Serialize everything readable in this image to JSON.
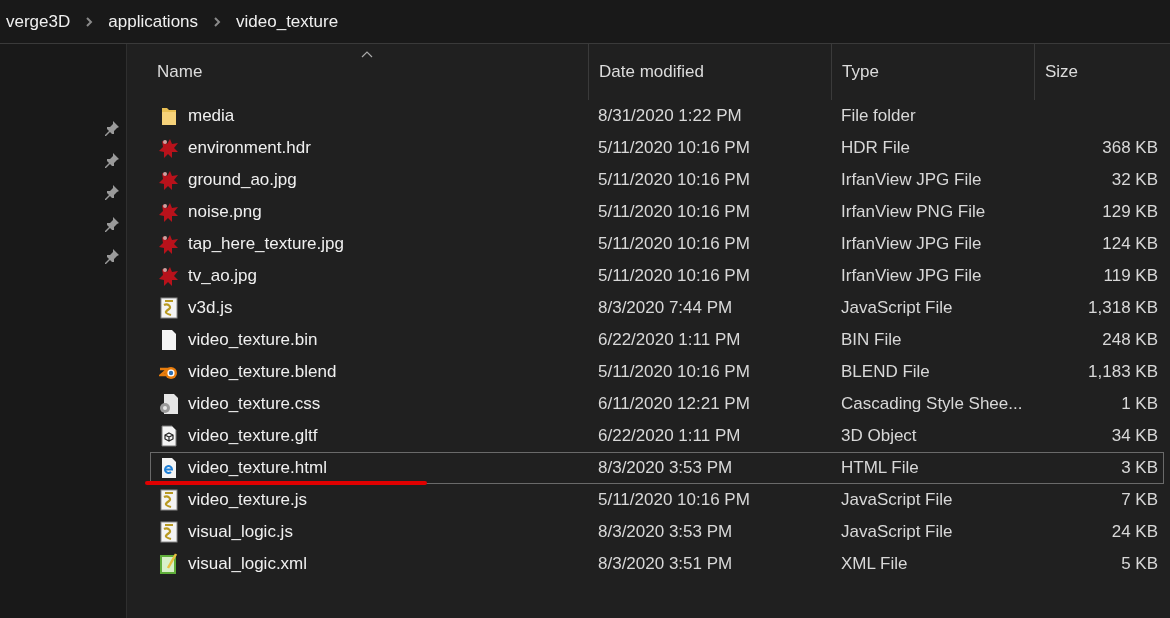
{
  "breadcrumb": [
    "verge3D",
    "applications",
    "video_texture"
  ],
  "columns": [
    {
      "label": "Name",
      "sorted": true
    },
    {
      "label": "Date modified",
      "sorted": false
    },
    {
      "label": "Type",
      "sorted": false
    },
    {
      "label": "Size",
      "sorted": false
    }
  ],
  "rows": [
    {
      "kind": "folder",
      "name": "media",
      "date": "8/31/2020 1:22 PM",
      "type": "File folder",
      "size": "",
      "focused": false,
      "underlined": false
    },
    {
      "kind": "irfanview",
      "name": "environment.hdr",
      "date": "5/11/2020 10:16 PM",
      "type": "HDR File",
      "size": "368 KB",
      "focused": false,
      "underlined": false
    },
    {
      "kind": "irfanview",
      "name": "ground_ao.jpg",
      "date": "5/11/2020 10:16 PM",
      "type": "IrfanView JPG File",
      "size": "32 KB",
      "focused": false,
      "underlined": false
    },
    {
      "kind": "irfanview",
      "name": "noise.png",
      "date": "5/11/2020 10:16 PM",
      "type": "IrfanView PNG File",
      "size": "129 KB",
      "focused": false,
      "underlined": false
    },
    {
      "kind": "irfanview",
      "name": "tap_here_texture.jpg",
      "date": "5/11/2020 10:16 PM",
      "type": "IrfanView JPG File",
      "size": "124 KB",
      "focused": false,
      "underlined": false
    },
    {
      "kind": "irfanview",
      "name": "tv_ao.jpg",
      "date": "5/11/2020 10:16 PM",
      "type": "IrfanView JPG File",
      "size": "119 KB",
      "focused": false,
      "underlined": false
    },
    {
      "kind": "script",
      "name": "v3d.js",
      "date": "8/3/2020 7:44 PM",
      "type": "JavaScript File",
      "size": "1,318 KB",
      "focused": false,
      "underlined": false
    },
    {
      "kind": "blank",
      "name": "video_texture.bin",
      "date": "6/22/2020 1:11 PM",
      "type": "BIN File",
      "size": "248 KB",
      "focused": false,
      "underlined": false
    },
    {
      "kind": "blender",
      "name": "video_texture.blend",
      "date": "5/11/2020 10:16 PM",
      "type": "BLEND File",
      "size": "1,183 KB",
      "focused": false,
      "underlined": false
    },
    {
      "kind": "css",
      "name": "video_texture.css",
      "date": "6/11/2020 12:21 PM",
      "type": "Cascading Style Shee...",
      "size": "1 KB",
      "focused": false,
      "underlined": false
    },
    {
      "kind": "model",
      "name": "video_texture.gltf",
      "date": "6/22/2020 1:11 PM",
      "type": "3D Object",
      "size": "34 KB",
      "focused": false,
      "underlined": false
    },
    {
      "kind": "browser",
      "name": "video_texture.html",
      "date": "8/3/2020 3:53 PM",
      "type": "HTML File",
      "size": "3 KB",
      "focused": true,
      "underlined": true
    },
    {
      "kind": "script",
      "name": "video_texture.js",
      "date": "5/11/2020 10:16 PM",
      "type": "JavaScript File",
      "size": "7 KB",
      "focused": false,
      "underlined": false
    },
    {
      "kind": "script",
      "name": "visual_logic.js",
      "date": "8/3/2020 3:53 PM",
      "type": "JavaScript File",
      "size": "24 KB",
      "focused": false,
      "underlined": false
    },
    {
      "kind": "xml",
      "name": "visual_logic.xml",
      "date": "8/3/2020 3:51 PM",
      "type": "XML File",
      "size": "5 KB",
      "focused": false,
      "underlined": false
    }
  ]
}
